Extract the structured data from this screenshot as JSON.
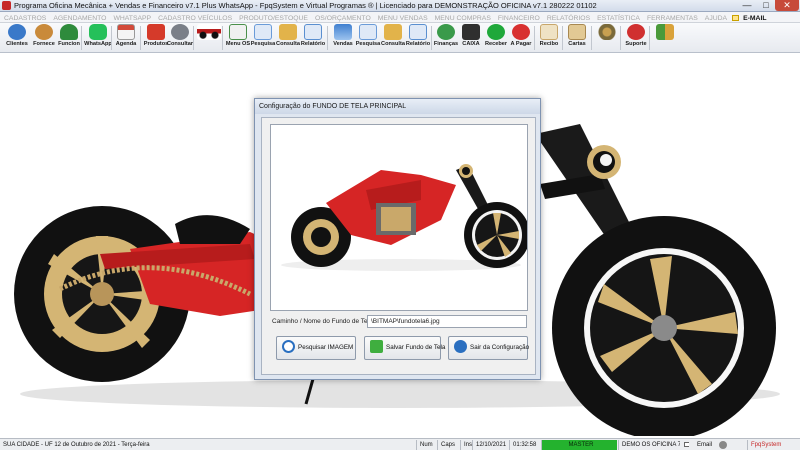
{
  "window": {
    "title": "Programa Oficina Mecânica + Vendas e Financeiro v7.1 Plus WhatsApp - FpqSystem e Virtual Programas ® | Licenciado para  DEMONSTRAÇÃO OFICINA v7.1 280222 01102",
    "min_glyph": "—",
    "max_glyph": "□",
    "close_glyph": "✕"
  },
  "menu": {
    "items": [
      "CADASTROS",
      "AGENDAMENTO",
      "WHATSAPP",
      "CADASTRO VEÍCULOS",
      "PRODUTO/ESTOQUE",
      "OS/ORÇAMENTO",
      "MENU VENDAS",
      "MENU COMPRAS",
      "FINANCEIRO",
      "RELATÓRIOS",
      "ESTATÍSTICA",
      "FERRAMENTAS",
      "AJUDA"
    ],
    "email_label": "E-MAIL"
  },
  "toolbar": {
    "items": [
      {
        "label": "Clientes",
        "icon": "clients-icon",
        "color": "#3a79c9"
      },
      {
        "label": "Fornece",
        "icon": "suppliers-icon",
        "color": "#c98a3a"
      },
      {
        "label": "Funcion",
        "icon": "employee-icon",
        "color": "#2e8b3c"
      },
      {
        "label": "WhatsApp",
        "icon": "whatsapp-icon",
        "color": "#25c05a"
      },
      {
        "label": "Agenda",
        "icon": "calendar-icon",
        "color": "#d24a3a"
      },
      {
        "label": "Produtos",
        "icon": "products-icon",
        "color": "#d53a2a"
      },
      {
        "label": "Consultar",
        "icon": "consult-icon",
        "color": "#7a7f88"
      },
      {
        "label": "",
        "icon": "motorcycle-icon",
        "color": "#b71c1c"
      },
      {
        "label": "Menu OS",
        "icon": "os-menu-icon",
        "color": "#4a8f4a"
      },
      {
        "label": "Pesquisa",
        "icon": "search-doc-icon",
        "color": "#6a9bd8"
      },
      {
        "label": "Consulta",
        "icon": "folder-icon",
        "color": "#e2b34a"
      },
      {
        "label": "Relatório",
        "icon": "report-icon",
        "color": "#5a8fd0"
      },
      {
        "label": "Vendas",
        "icon": "sales-icon",
        "color": "#3f7fd0"
      },
      {
        "label": "Pesquisa",
        "icon": "search-doc-icon",
        "color": "#6a9bd8"
      },
      {
        "label": "Consulta",
        "icon": "folder-icon",
        "color": "#e2b34a"
      },
      {
        "label": "Relatório",
        "icon": "report-icon",
        "color": "#5a8fd0"
      },
      {
        "label": "Finanças",
        "icon": "finance-icon",
        "color": "#3a9a4a"
      },
      {
        "label": "CAIXA",
        "icon": "cashbox-icon",
        "color": "#2f2f2f"
      },
      {
        "label": "Receber",
        "icon": "receive-money-icon",
        "color": "#1fa83a"
      },
      {
        "label": "A Pagar",
        "icon": "pay-money-icon",
        "color": "#d83030"
      },
      {
        "label": "Recibo",
        "icon": "receipt-icon",
        "color": "#c8a66a"
      },
      {
        "label": "Cartas",
        "icon": "letters-icon",
        "color": "#c8a66a"
      },
      {
        "label": "",
        "icon": "tools-icon",
        "color": "#7a6a3a"
      },
      {
        "label": "Suporte",
        "icon": "support-icon",
        "color": "#d03030"
      },
      {
        "label": "",
        "icon": "exit-icon",
        "color": "#4a9a3a"
      }
    ]
  },
  "dialog": {
    "title": "Configuração do FUNDO DE TELA PRINCIPAL",
    "path_label": "Caminho / Nome do Fundo de Tela",
    "path_value": "\\BITMAP\\fundotela6.jpg",
    "buttons": {
      "search": "Pesquisar IMAGEM",
      "save": "Salvar Fundo de Tela",
      "exit": "Sair da Configuração"
    }
  },
  "status": {
    "city": "SUA CIDADE - UF 12 de Outubro de 2021 - Terça-feira",
    "num": "Num",
    "caps": "Caps",
    "ins": "Ins",
    "date": "12/10/2021",
    "time": "01:32:58",
    "master": "MASTER",
    "company": "DEMO OS OFICINA 7.1",
    "email": "Email",
    "brand": "FpqSystem"
  },
  "colors": {
    "bike_red": "#d62525",
    "bike_gold": "#d4b574",
    "bike_black": "#111111",
    "master_green": "#24b22e"
  }
}
